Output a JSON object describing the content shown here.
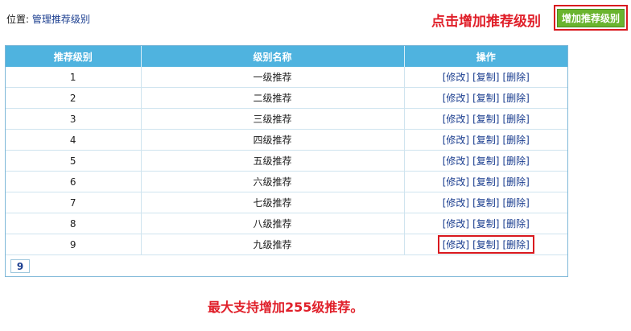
{
  "breadcrumb": {
    "label": "位置:",
    "current": "管理推荐级别"
  },
  "hints": {
    "top": "点击增加推荐级别",
    "bottom": "最大支持增加255级推荐。"
  },
  "toolbar": {
    "add_label": "增加推荐级别"
  },
  "table": {
    "columns": [
      "推荐级别",
      "级别名称",
      "操作"
    ],
    "ops": {
      "edit": "[修改]",
      "copy": "[复制]",
      "delete": "[删除]"
    },
    "rows": [
      {
        "level": "1",
        "name": "一级推荐"
      },
      {
        "level": "2",
        "name": "二级推荐"
      },
      {
        "level": "3",
        "name": "三级推荐"
      },
      {
        "level": "4",
        "name": "四级推荐"
      },
      {
        "level": "5",
        "name": "五级推荐"
      },
      {
        "level": "6",
        "name": "六级推荐"
      },
      {
        "level": "7",
        "name": "七级推荐"
      },
      {
        "level": "8",
        "name": "八级推荐"
      },
      {
        "level": "9",
        "name": "九级推荐"
      }
    ]
  },
  "pagination": {
    "current": "9"
  },
  "colors": {
    "header_bg": "#4fb3df",
    "add_button": "#6ab42e",
    "highlight_red": "#d9191f"
  }
}
